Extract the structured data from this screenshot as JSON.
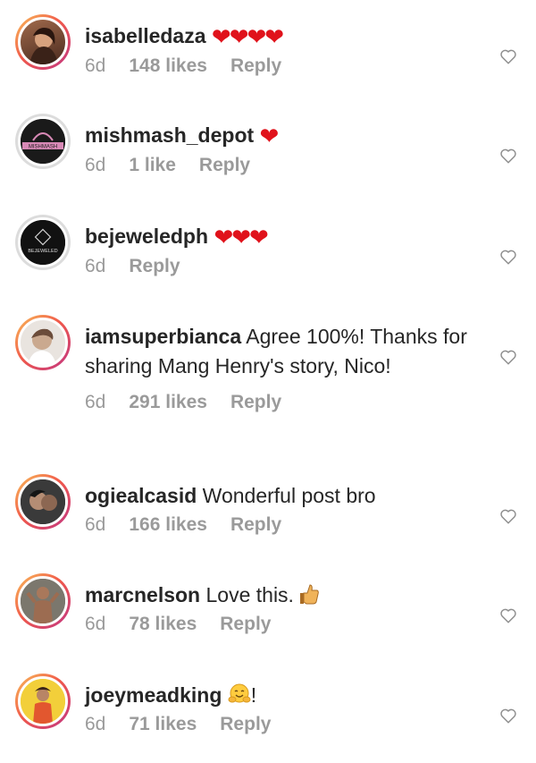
{
  "comments": [
    {
      "username": "isabelledaza",
      "text": "",
      "emoji": "❤❤❤❤",
      "time": "6d",
      "likes": "148 likes",
      "reply": "Reply"
    },
    {
      "username": "mishmash_depot",
      "text": "",
      "emoji": "❤",
      "time": "6d",
      "likes": "1 like",
      "reply": "Reply"
    },
    {
      "username": "bejeweledph",
      "text": "",
      "emoji": "❤❤❤",
      "time": "6d",
      "likes": "",
      "reply": "Reply"
    },
    {
      "username": "iamsuperbianca",
      "text": "Agree 100%! Thanks for sharing Mang Henry's story, Nico!",
      "emoji": "",
      "time": "6d",
      "likes": "291 likes",
      "reply": "Reply"
    },
    {
      "username": "ogiealcasid",
      "text": "Wonderful post bro",
      "emoji": "",
      "time": "6d",
      "likes": "166 likes",
      "reply": "Reply"
    },
    {
      "username": "marcnelson",
      "text": "Love this.",
      "emoji": "thumbs-up",
      "time": "6d",
      "likes": "78 likes",
      "reply": "Reply"
    },
    {
      "username": "joeymeadking",
      "text": "!",
      "emoji": "hugging-face",
      "time": "6d",
      "likes": "71 likes",
      "reply": "Reply"
    }
  ],
  "avatar_text": {
    "mishmash": "MISHMASH",
    "bejeweled": "BEJEWELED"
  },
  "colors": {
    "heart": "#e0121b",
    "meta": "#9a9a9a",
    "text": "#262626",
    "ring_start": "#f9c15a",
    "ring_end": "#c13584"
  }
}
